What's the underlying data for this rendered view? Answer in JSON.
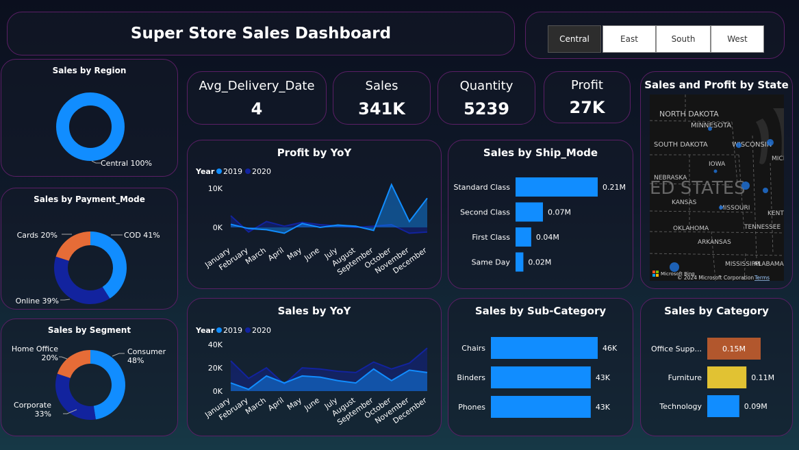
{
  "header": {
    "title": "Super Store Sales Dashboard"
  },
  "slicer": {
    "items": [
      "Central",
      "East",
      "South",
      "West"
    ],
    "selected": "Central"
  },
  "kpis": [
    {
      "label": "Avg_Delivery_Date",
      "value": "4"
    },
    {
      "label": "Sales",
      "value": "341K"
    },
    {
      "label": "Quantity",
      "value": "5239"
    },
    {
      "label": "Profit",
      "value": "27K"
    }
  ],
  "map": {
    "title": "Sales and Profit by State",
    "labels": [
      "NORTH DAKOTA",
      "MINNESOTA",
      "SOUTH DAKOTA",
      "WISCONSIN",
      "MICHIG",
      "IOWA",
      "NEBRASKA",
      "ED STATES",
      "KANSAS",
      "MISSOURI",
      "KENTUCK",
      "OKLAHOMA",
      "TENNESSEE",
      "ARKANSAS",
      "MISSISSIPPI",
      "ALABAMA"
    ],
    "credit": "© 2024 Microsoft Corporation",
    "terms": "Terms",
    "bing": "Microsoft Bing",
    "dot_color": "#1f6fd1"
  },
  "colors": {
    "blue": "#118dff",
    "navy": "#12239e",
    "orange": "#e66c37",
    "yellow": "#e1c233",
    "brown": "#b2572d"
  },
  "chart_data": [
    {
      "id": "region",
      "type": "pie",
      "title": "Sales by Region",
      "donut": true,
      "slices": [
        {
          "label": "Central",
          "value": 100,
          "text": "Central 100%",
          "color": "#118dff"
        }
      ]
    },
    {
      "id": "payment",
      "type": "pie",
      "title": "Sales by Payment_Mode",
      "donut": true,
      "slices": [
        {
          "label": "COD",
          "value": 41,
          "text": "COD 41%",
          "color": "#118dff"
        },
        {
          "label": "Online",
          "value": 39,
          "text": "Online 39%",
          "color": "#12239e"
        },
        {
          "label": "Cards",
          "value": 20,
          "text": "Cards 20%",
          "color": "#e66c37"
        }
      ]
    },
    {
      "id": "segment",
      "type": "pie",
      "title": "Sales by Segment",
      "donut": true,
      "slices": [
        {
          "label": "Consumer",
          "value": 48,
          "text": [
            "Consumer",
            "48%"
          ],
          "color": "#118dff"
        },
        {
          "label": "Corporate",
          "value": 33,
          "text": [
            "Corporate",
            "33%"
          ],
          "color": "#12239e"
        },
        {
          "label": "Home Office",
          "value": 20,
          "text": [
            "Home Office",
            "20%"
          ],
          "color": "#e66c37"
        }
      ]
    },
    {
      "id": "profit_yoy",
      "type": "area",
      "title": "Profit by YoY",
      "legend_title": "Year",
      "categories": [
        "January",
        "February",
        "March",
        "April",
        "May",
        "June",
        "July",
        "August",
        "September",
        "October",
        "November",
        "December"
      ],
      "series": [
        {
          "name": "2019",
          "color": "#118dff",
          "values": [
            800,
            -300,
            -600,
            -1500,
            1000,
            0,
            600,
            300,
            -800,
            11000,
            1500,
            7500
          ]
        },
        {
          "name": "2020",
          "color": "#12239e",
          "values": [
            3000,
            -1200,
            1500,
            300,
            1300,
            700,
            400,
            0,
            300,
            700,
            -1500,
            -1200
          ]
        }
      ],
      "yticks": [
        {
          "v": 0,
          "t": "0K"
        },
        {
          "v": 10000,
          "t": "10K"
        }
      ],
      "ylim": [
        -3000,
        12500
      ]
    },
    {
      "id": "sales_yoy",
      "type": "area",
      "title": "Sales by YoY",
      "legend_title": "Year",
      "categories": [
        "January",
        "February",
        "March",
        "April",
        "May",
        "June",
        "July",
        "August",
        "September",
        "October",
        "November",
        "December"
      ],
      "series": [
        {
          "name": "2019",
          "color": "#118dff",
          "values": [
            7000,
            1500,
            13000,
            7000,
            13000,
            12000,
            9000,
            7000,
            19000,
            9000,
            18000,
            16000
          ]
        },
        {
          "name": "2020",
          "color": "#12239e",
          "values": [
            26000,
            11000,
            20000,
            6000,
            20000,
            19000,
            17000,
            16000,
            25000,
            19000,
            24000,
            37000
          ]
        }
      ],
      "yticks": [
        {
          "v": 0,
          "t": "0K"
        },
        {
          "v": 20000,
          "t": "20K"
        },
        {
          "v": 40000,
          "t": "40K"
        }
      ],
      "ylim": [
        0,
        43000
      ]
    },
    {
      "id": "ship_mode",
      "type": "bar",
      "title": "Sales by Ship_Mode",
      "orientation": "horizontal",
      "categories": [
        "Standard Class",
        "Second Class",
        "First Class",
        "Same Day"
      ],
      "values": [
        0.21,
        0.07,
        0.04,
        0.02
      ],
      "labels": [
        "0.21M",
        "0.07M",
        "0.04M",
        "0.02M"
      ],
      "xlim": [
        0,
        0.21
      ]
    },
    {
      "id": "sub_category",
      "type": "bar",
      "title": "Sales by Sub-Category",
      "orientation": "horizontal",
      "categories": [
        "Chairs",
        "Binders",
        "Phones"
      ],
      "values": [
        46,
        43,
        43
      ],
      "labels": [
        "46K",
        "43K",
        "43K"
      ],
      "xlim": [
        0,
        46
      ]
    },
    {
      "id": "category",
      "type": "bar",
      "title": "Sales by Category",
      "orientation": "horizontal",
      "categories": [
        "Office Supp...",
        "Furniture",
        "Technology"
      ],
      "values": [
        0.15,
        0.11,
        0.09
      ],
      "labels": [
        "0.15M",
        "0.11M",
        "0.09M"
      ],
      "colors": [
        "#b2572d",
        "#e1c233",
        "#118dff"
      ],
      "xlim": [
        0,
        0.15
      ]
    }
  ]
}
